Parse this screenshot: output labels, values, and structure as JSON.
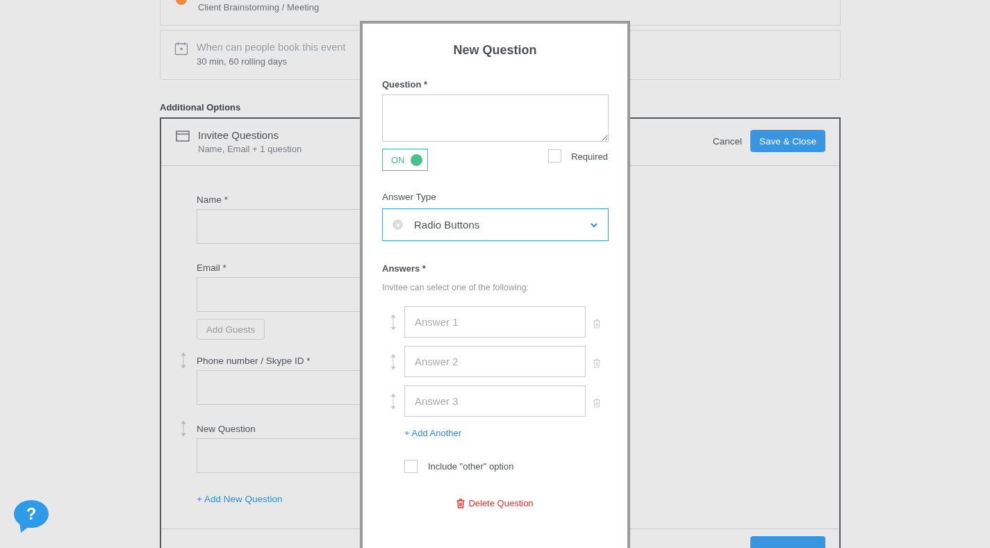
{
  "event_cards": [
    {
      "kind": "dot",
      "subtitle": "Client Brainstorming / Meeting"
    },
    {
      "kind": "calendar",
      "title": "When can people book this event",
      "subtitle": "30 min, 60 rolling days"
    }
  ],
  "section_heading": "Additional Options",
  "invitee_questions": {
    "title": "Invitee Questions",
    "subtitle": "Name, Email + 1 question",
    "cancel": "Cancel",
    "save": "Save & Close",
    "fields": [
      {
        "label": "Name *",
        "draggable": false
      },
      {
        "label": "Email *",
        "draggable": false,
        "extra_button": "Add Guests"
      },
      {
        "label": "Phone number / Skype ID *",
        "draggable": true
      },
      {
        "label": "New Question",
        "draggable": true
      }
    ],
    "add_link": "+ Add New Question"
  },
  "help_button": "?",
  "modal": {
    "title": "New Question",
    "question_label": "Question *",
    "toggle": {
      "label": "ON",
      "on": true
    },
    "required": {
      "label": "Required",
      "checked": false
    },
    "answer_type_label": "Answer Type",
    "answer_type": "Radio Buttons",
    "answers_label": "Answers *",
    "answers_hint": "Invitee can select one of the following:",
    "answers": [
      {
        "placeholder": "Answer 1"
      },
      {
        "placeholder": "Answer 2"
      },
      {
        "placeholder": "Answer 3"
      }
    ],
    "add_another": "+ Add Another",
    "include_other": {
      "label": "Include \"other\" option",
      "checked": false
    },
    "delete": "Delete Question"
  }
}
